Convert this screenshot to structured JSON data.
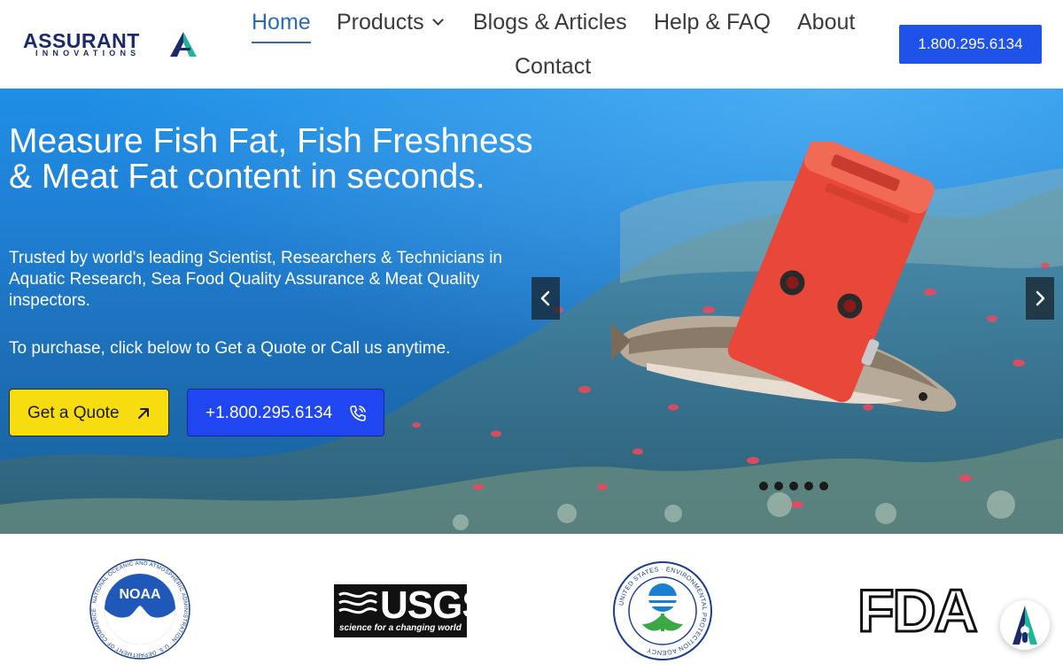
{
  "brand": {
    "name": "ASSURANT",
    "tagline": "INNOVATIONS",
    "colors": {
      "navy": "#1b2a6b",
      "teal": "#1fb59a",
      "primary_blue": "#1f52e8",
      "cta_yellow": "#f7dc10"
    }
  },
  "nav": {
    "items": [
      {
        "label": "Home",
        "active": true
      },
      {
        "label": "Products",
        "has_dropdown": true
      },
      {
        "label": "Blogs & Articles"
      },
      {
        "label": "Help & FAQ"
      },
      {
        "label": "About"
      },
      {
        "label": "Contact"
      }
    ],
    "phone_button": "1.800.295.6134"
  },
  "hero": {
    "title": "Measure Fish Fat, Fish Freshness & Meat Fat content in seconds.",
    "subtitle": "Trusted by world's leading Scientist, Researchers & Technicians in Aquatic Research, Sea Food Quality Assurance & Meat Quality inspectors.",
    "cta_text": "To purchase, click below to Get a Quote or Call us anytime.",
    "quote_button": "Get a Quote",
    "call_button": "+1.800.295.6134",
    "slider": {
      "slide_count": 5,
      "active_slide": 1
    }
  },
  "partners": {
    "noaa": {
      "center": "NOAA",
      "ring_text": "NATIONAL OCEANIC AND ATMOSPHERIC ADMINISTRATION · U.S. DEPARTMENT OF COMMERCE"
    },
    "usgs": {
      "word": "USGS",
      "tagline": "science for a changing world"
    },
    "epa": {
      "ring_text": "UNITED STATES · ENVIRONMENTAL PROTECTION AGENCY"
    },
    "fda": {
      "word": "FDA"
    }
  },
  "icons": {
    "quote": "arrow-up-right-icon",
    "call": "phone-icon",
    "prev": "chevron-left-icon",
    "next": "chevron-right-icon",
    "chat": "assistant-chat-icon"
  }
}
